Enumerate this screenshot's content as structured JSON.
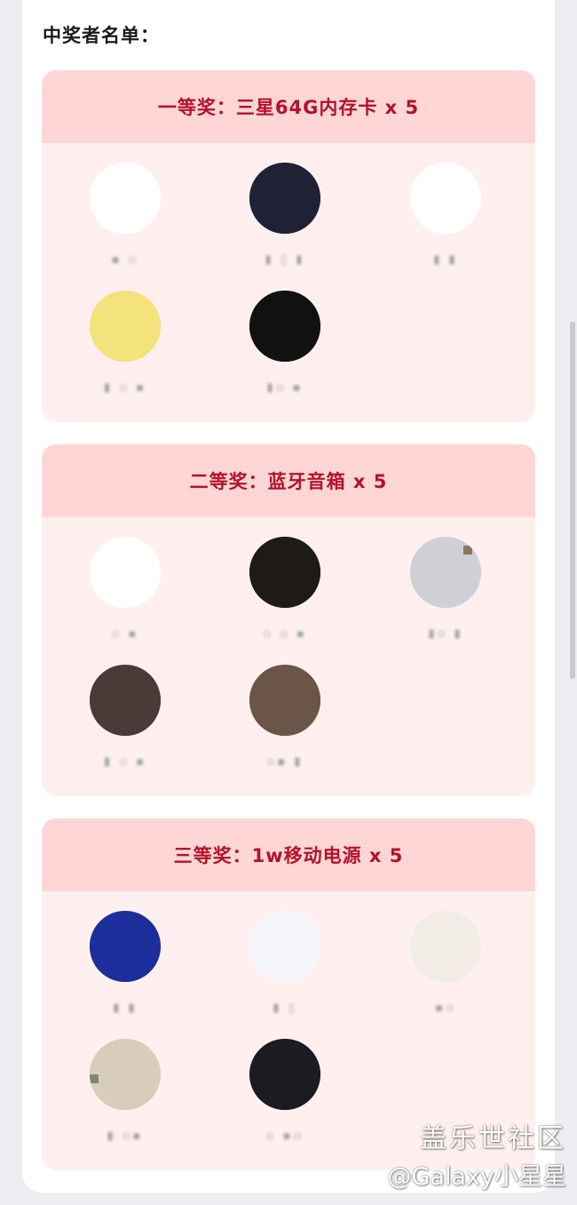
{
  "title": "中奖者名单：",
  "prizes": [
    {
      "label": "一等奖：三星64G内存卡 x 5",
      "winners": [
        {
          "avatar": "pikachu-avatar",
          "colors": [
            "#ffffff",
            "#f6dc2a",
            "#2b2b2b",
            "#d94b2c"
          ],
          "nickname": "▪ ▫"
        },
        {
          "avatar": "sunset-photo-avatar",
          "colors": [
            "#1f2235",
            "#6a5a6d",
            "#e3a361",
            "#2a2a2a"
          ],
          "nickname": "▮ ▯ ▮"
        },
        {
          "avatar": "penguin-avatar",
          "colors": [
            "#ffffff",
            "#d8d8d8",
            "#2a2a2a",
            "#9a9a9a"
          ],
          "nickname": "▮  ▮"
        },
        {
          "avatar": "cartoon-boy-avatar",
          "colors": [
            "#f4e27a",
            "#5a3b2c",
            "#a0785a",
            "#7c66c9"
          ],
          "nickname": "▮ ▫ ▪"
        },
        {
          "avatar": "dark-figure-avatar",
          "colors": [
            "#111111",
            "#1b1b1b",
            "#e8e8e8",
            "#4d4d4d"
          ],
          "nickname": "▮▫ ▪"
        }
      ]
    },
    {
      "label": "二等奖：蓝牙音箱 x 5",
      "winners": [
        {
          "avatar": "dancer-avatar",
          "colors": [
            "#ffffff",
            "#c99a6b",
            "#3f3f3f",
            "#e3c29a"
          ],
          "nickname": "▫ ▪"
        },
        {
          "avatar": "night-street-avatar",
          "colors": [
            "#1d1a17",
            "#7a5a31",
            "#c7a46e",
            "#2c2520"
          ],
          "nickname": "▫ ▫ ▪"
        },
        {
          "avatar": "landscape-avatar",
          "colors": [
            "#cfcfd6",
            "#8a7760",
            "#5a4f45",
            "#f0eee9"
          ],
          "nickname": "▮▫ ▮"
        },
        {
          "avatar": "couple-photo-avatar",
          "colors": [
            "#4a3a38",
            "#b48c7a",
            "#2b3a5a",
            "#e4d0c0"
          ],
          "nickname": "▮ ▫ ▪"
        },
        {
          "avatar": "girl-photo-avatar",
          "colors": [
            "#6a5548",
            "#d8c0a8",
            "#5a5a7a",
            "#ece2d6"
          ],
          "nickname": "▫▪ ▮"
        }
      ]
    },
    {
      "label": "三等奖：1w移动电源 x 5",
      "winners": [
        {
          "avatar": "blue-yellow-avatar",
          "colors": [
            "#1c2e9a",
            "#f3df47",
            "#7b88d8",
            "#0f1a66"
          ],
          "nickname": "▮ ▮"
        },
        {
          "avatar": "cloud-avatar",
          "colors": [
            "#f4f6fa",
            "#dfe6f0",
            "#b8c6d8",
            "#ffffff"
          ],
          "nickname": "▮ ▯"
        },
        {
          "avatar": "woman-photo-avatar",
          "colors": [
            "#f2ece6",
            "#3a2a24",
            "#c79a86",
            "#e0d0c4"
          ],
          "nickname": "▪▫"
        },
        {
          "avatar": "cat-avatar",
          "colors": [
            "#d8cdbb",
            "#7d8a6a",
            "#f0e6d6",
            "#5a6a4a"
          ],
          "nickname": "▮ ▫▪"
        },
        {
          "avatar": "galaxy-avatar",
          "colors": [
            "#1a1c22",
            "#5a6070",
            "#cfc0a8",
            "#2e3340"
          ],
          "nickname": "▫ ▪▫"
        }
      ]
    }
  ],
  "watermark": {
    "line1": "盖乐世社区",
    "line2": "@Galaxy小星星"
  }
}
